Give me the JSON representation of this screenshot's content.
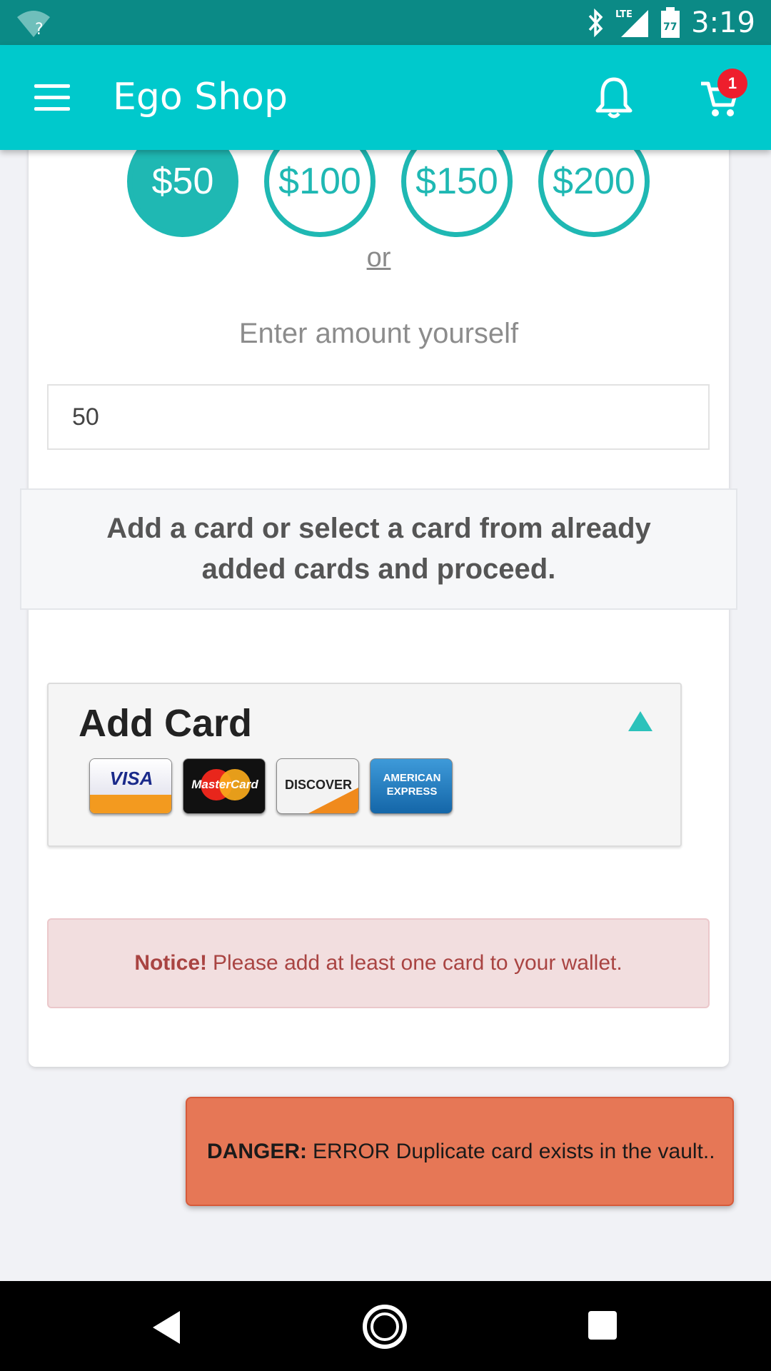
{
  "status_bar": {
    "time": "3:19",
    "network": "LTE",
    "battery": "77",
    "wifi_symbol": "?"
  },
  "app_bar": {
    "title": "Ego Shop",
    "cart_count": "1"
  },
  "amount_options": [
    "$50",
    "$100",
    "$150",
    "$200"
  ],
  "selected_amount": "$50",
  "or_text": "or",
  "enter_label": "Enter amount yourself",
  "amount_input": {
    "value": "50",
    "placeholder": ""
  },
  "info_text": "Add a card or select a card from already added cards and proceed.",
  "add_card": {
    "title": "Add Card",
    "logos": [
      "VISA",
      "MasterCard",
      "DISCOVER",
      "AMERICAN EXPRESS"
    ]
  },
  "notice": {
    "label": "Notice!",
    "message": "Please add at least one card to your wallet."
  },
  "toast": {
    "label": "DANGER:",
    "message": "ERROR Duplicate card exists in the vault.."
  },
  "colors": {
    "status_bar": "#0b8a86",
    "app_bar": "#00c9cc",
    "accent": "#1fb8b3",
    "badge": "#ee1e2d",
    "danger_toast": "#e67756",
    "notice_bg": "#f2dedf",
    "notice_text": "#a94442"
  }
}
